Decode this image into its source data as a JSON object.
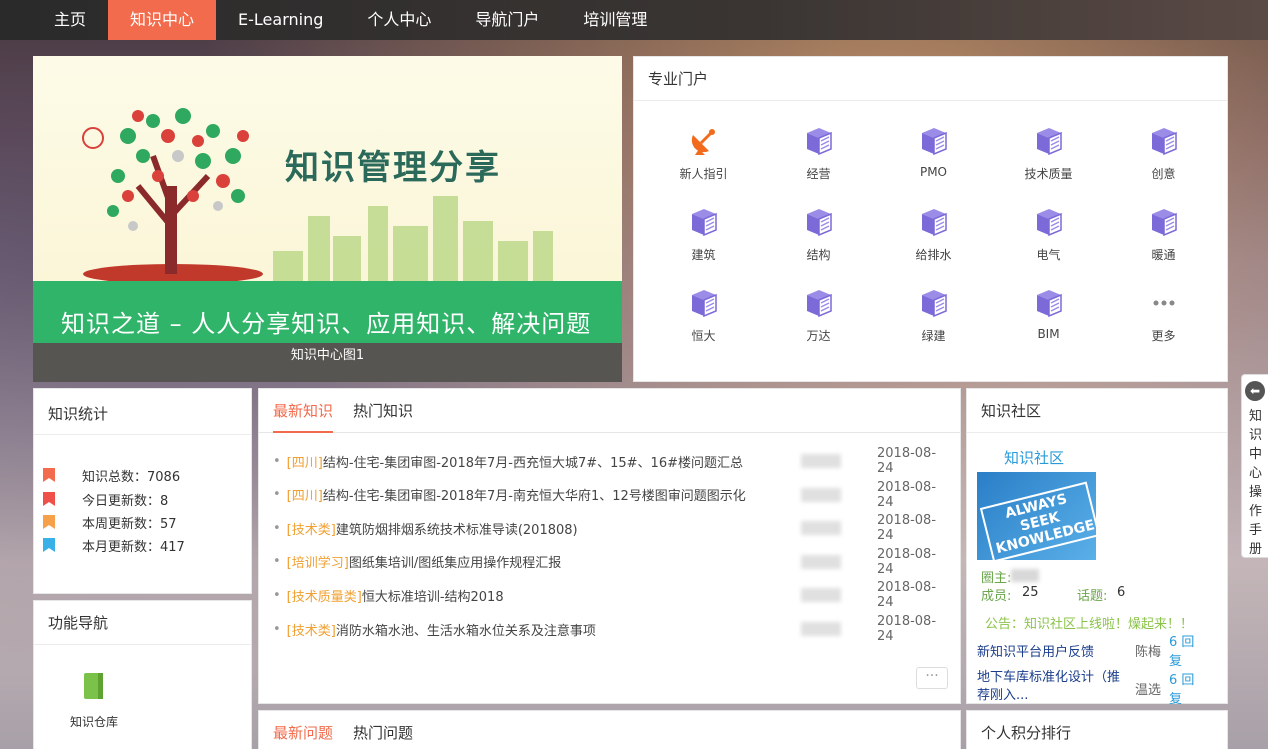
{
  "nav": {
    "items": [
      "主页",
      "知识中心",
      "E-Learning",
      "个人中心",
      "导航门户",
      "培训管理"
    ],
    "active_index": 1
  },
  "banner": {
    "title": "知识管理分享",
    "slogan": "知识之道 – 人人分享知识、应用知识、解决问题",
    "caption": "知识中心图1"
  },
  "portal": {
    "title": "专业门户",
    "items": [
      {
        "label": "新人指引",
        "icon": "satellite-dish-icon"
      },
      {
        "label": "经营",
        "icon": "book-stack-icon"
      },
      {
        "label": "PMO",
        "icon": "book-stack-icon"
      },
      {
        "label": "技术质量",
        "icon": "book-stack-icon"
      },
      {
        "label": "创意",
        "icon": "book-stack-icon"
      },
      {
        "label": "建筑",
        "icon": "book-stack-icon"
      },
      {
        "label": "结构",
        "icon": "book-stack-icon"
      },
      {
        "label": "给排水",
        "icon": "book-stack-icon"
      },
      {
        "label": "电气",
        "icon": "book-stack-icon"
      },
      {
        "label": "暖通",
        "icon": "book-stack-icon"
      },
      {
        "label": "恒大",
        "icon": "book-stack-icon"
      },
      {
        "label": "万达",
        "icon": "book-stack-icon"
      },
      {
        "label": "绿建",
        "icon": "book-stack-icon"
      },
      {
        "label": "BIM",
        "icon": "book-stack-icon"
      },
      {
        "label": "更多",
        "icon": "more-dots-icon"
      }
    ]
  },
  "stats": {
    "title": "知识统计",
    "rows": [
      {
        "label": "知识总数：7086",
        "color": "#f26b4d"
      },
      {
        "label": "今日更新数：8",
        "color": "#f0504a"
      },
      {
        "label": "本周更新数：57",
        "color": "#f7a04a"
      },
      {
        "label": "本月更新数：417",
        "color": "#39b0e8"
      }
    ]
  },
  "func_nav": {
    "title": "功能导航",
    "item_label": "知识仓库"
  },
  "knowledge": {
    "tabs": [
      "最新知识",
      "热门知识"
    ],
    "rows": [
      {
        "cat": "[四川]",
        "title": "结构-住宅-集团审图-2018年7月-西充恒大城7#、15#、16#楼问题汇总",
        "date": "2018-08-24"
      },
      {
        "cat": "[四川]",
        "title": "结构-住宅-集团审图-2018年7月-南充恒大华府1、12号楼图审问题图示化",
        "date": "2018-08-24"
      },
      {
        "cat": "[技术类]",
        "title": "建筑防烟排烟系统技术标准导读(201808)",
        "date": "2018-08-24"
      },
      {
        "cat": "[培训学习]",
        "title": "图纸集培训/图纸集应用操作规程汇报",
        "date": "2018-08-24"
      },
      {
        "cat": "[技术质量类]",
        "title": "恒大标准培训-结构2018",
        "date": "2018-08-24"
      },
      {
        "cat": "[技术类]",
        "title": "消防水箱水池、生活水箱水位关系及注意事项",
        "date": "2018-08-24"
      }
    ],
    "more": "···"
  },
  "questions": {
    "tabs": [
      "最新问题",
      "热门问题"
    ]
  },
  "community": {
    "title": "知识社区",
    "name": "知识社区",
    "image_text": "ALWAYS SEEK KNOWLEDGE",
    "owner_label": "圈主:",
    "members_label": "成员:",
    "members": "25",
    "topics_label": "话题:",
    "topics": "6",
    "notice": "公告：知识社区上线啦！燥起来！！",
    "posts": [
      {
        "title": "新知识平台用户反馈",
        "author": "陈梅",
        "replies": "6 回复"
      },
      {
        "title": "地下车库标准化设计（推荐刚入...",
        "author": "温选",
        "replies": "6 回复"
      }
    ]
  },
  "ranking": {
    "title": "个人积分排行"
  },
  "side_tab": {
    "label": "知识中心操作手册"
  }
}
